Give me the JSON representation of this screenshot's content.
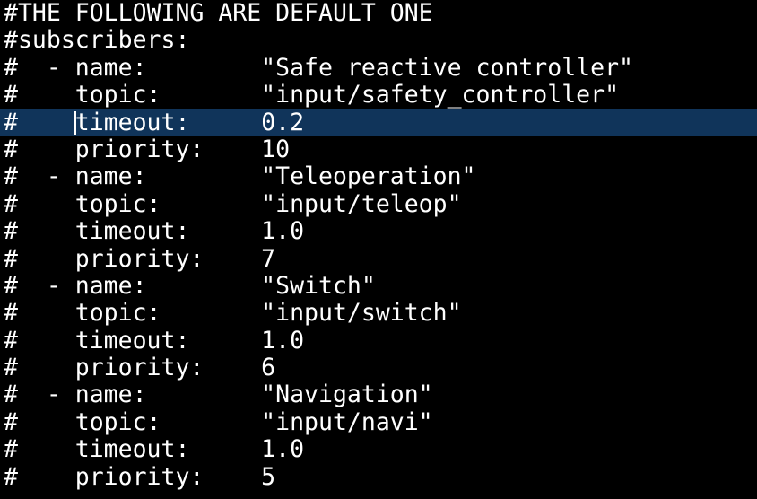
{
  "editor": {
    "cursor_line": 4,
    "cursor_col": 5,
    "lines": [
      "#THE FOLLOWING ARE DEFAULT ONE",
      "#subscribers:",
      "#  - name:        \"Safe reactive controller\"",
      "#    topic:       \"input/safety_controller\"",
      "#    timeout:     0.2",
      "#    priority:    10",
      "#  - name:        \"Teleoperation\"",
      "#    topic:       \"input/teleop\"",
      "#    timeout:     1.0",
      "#    priority:    7",
      "#  - name:        \"Switch\"",
      "#    topic:       \"input/switch\"",
      "#    timeout:     1.0",
      "#    priority:    6",
      "#  - name:        \"Navigation\"",
      "#    topic:       \"input/navi\"",
      "#    timeout:     1.0",
      "#    priority:    5"
    ]
  },
  "colors": {
    "background": "#000000",
    "text": "#ffffff",
    "highlight": "#10345a"
  }
}
